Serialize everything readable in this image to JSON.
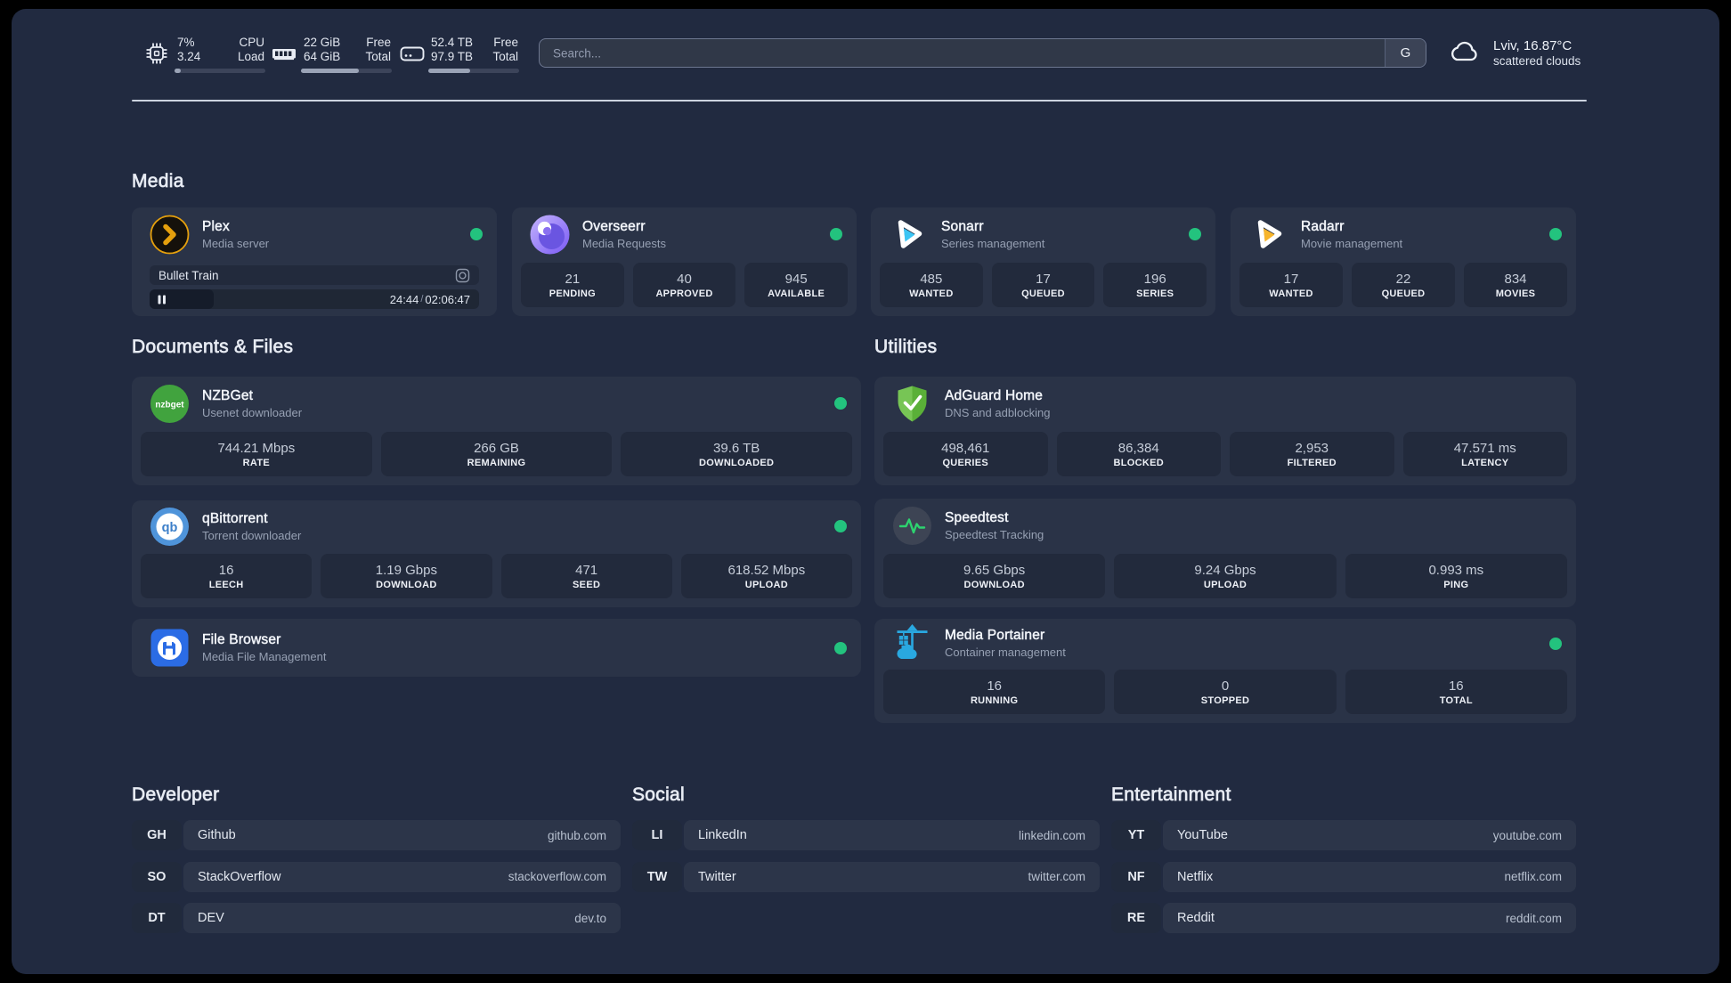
{
  "topbar": {
    "cpu": {
      "icon": "cpu-icon",
      "value_top": "7%",
      "value_bottom": "3.24",
      "label_top": "CPU",
      "label_bottom": "Load",
      "progress_percent": 7
    },
    "memory": {
      "icon": "ram-icon",
      "value_top": "22 GiB",
      "value_bottom": "64 GiB",
      "label_top": "Free",
      "label_bottom": "Total",
      "progress_percent": 64
    },
    "disk": {
      "icon": "disk-icon",
      "value_top": "52.4 TB",
      "value_bottom": "97.9 TB",
      "label_top": "Free",
      "label_bottom": "Total",
      "progress_percent": 46
    },
    "search": {
      "placeholder": "Search...",
      "button_label": "G"
    },
    "weather": {
      "icon": "cloud-icon",
      "line1": "Lviv, 16.87°C",
      "line2": "scattered clouds"
    }
  },
  "app_sections": [
    {
      "id": "media",
      "heading": "Media",
      "cards": [
        {
          "id": "plex",
          "icon": "plex-icon",
          "title": "Plex",
          "subtitle": "Media server",
          "status_dot": true,
          "player": {
            "track_title": "Bullet Train",
            "track_icon": "disc-icon",
            "state_icon": "pause-icon",
            "position": "24:44",
            "duration": "02:06:47",
            "progress_percent": 19.5
          }
        },
        {
          "id": "overseerr",
          "icon": "overseerr-icon",
          "title": "Overseerr",
          "subtitle": "Media Requests",
          "status_dot": true,
          "stats": [
            {
              "value": "21",
              "label": "PENDING"
            },
            {
              "value": "40",
              "label": "APPROVED"
            },
            {
              "value": "945",
              "label": "AVAILABLE"
            }
          ]
        },
        {
          "id": "sonarr",
          "icon": "sonarr-icon",
          "title": "Sonarr",
          "subtitle": "Series management",
          "status_dot": true,
          "stats": [
            {
              "value": "485",
              "label": "WANTED"
            },
            {
              "value": "17",
              "label": "QUEUED"
            },
            {
              "value": "196",
              "label": "SERIES"
            }
          ]
        },
        {
          "id": "radarr",
          "icon": "radarr-icon",
          "title": "Radarr",
          "subtitle": "Movie management",
          "status_dot": true,
          "stats": [
            {
              "value": "17",
              "label": "WANTED"
            },
            {
              "value": "22",
              "label": "QUEUED"
            },
            {
              "value": "834",
              "label": "MOVIES"
            }
          ]
        }
      ]
    },
    {
      "id": "documents",
      "heading": "Documents & Files",
      "cards": [
        {
          "id": "nzbget",
          "icon": "nzbget-icon",
          "title": "NZBGet",
          "subtitle": "Usenet downloader",
          "status_dot": true,
          "stats": [
            {
              "value": "744.21 Mbps",
              "label": "RATE"
            },
            {
              "value": "266 GB",
              "label": "REMAINING"
            },
            {
              "value": "39.6 TB",
              "label": "DOWNLOADED"
            }
          ]
        },
        {
          "id": "qbittorrent",
          "icon": "qbittorrent-icon",
          "title": "qBittorrent",
          "subtitle": "Torrent downloader",
          "status_dot": true,
          "stats": [
            {
              "value": "16",
              "label": "LEECH"
            },
            {
              "value": "1.19 Gbps",
              "label": "DOWNLOAD"
            },
            {
              "value": "471",
              "label": "SEED"
            },
            {
              "value": "618.52 Mbps",
              "label": "UPLOAD"
            }
          ]
        },
        {
          "id": "filebrowser",
          "icon": "filebrowser-icon",
          "title": "File Browser",
          "subtitle": "Media File Management",
          "status_dot": true,
          "stats": null
        }
      ]
    },
    {
      "id": "utilities",
      "heading": "Utilities",
      "cards": [
        {
          "id": "adguard",
          "icon": "adguard-icon",
          "title": "AdGuard Home",
          "subtitle": "DNS and adblocking",
          "status_dot": false,
          "stats": [
            {
              "value": "498,461",
              "label": "QUERIES"
            },
            {
              "value": "86,384",
              "label": "BLOCKED"
            },
            {
              "value": "2,953",
              "label": "FILTERED"
            },
            {
              "value": "47.571 ms",
              "label": "LATENCY"
            }
          ]
        },
        {
          "id": "speedtest",
          "icon": "speedtest-icon",
          "title": "Speedtest",
          "subtitle": "Speedtest Tracking",
          "status_dot": false,
          "stats": [
            {
              "value": "9.65 Gbps",
              "label": "DOWNLOAD"
            },
            {
              "value": "9.24 Gbps",
              "label": "UPLOAD"
            },
            {
              "value": "0.993 ms",
              "label": "PING"
            }
          ]
        },
        {
          "id": "portainer",
          "icon": "portainer-icon",
          "title": "Media Portainer",
          "subtitle": "Container management",
          "status_dot": true,
          "stats": [
            {
              "value": "16",
              "label": "RUNNING"
            },
            {
              "value": "0",
              "label": "STOPPED"
            },
            {
              "value": "16",
              "label": "TOTAL"
            }
          ]
        }
      ]
    }
  ],
  "link_sections": [
    {
      "id": "developer",
      "heading": "Developer",
      "links": [
        {
          "abbr": "GH",
          "name": "Github",
          "url": "github.com"
        },
        {
          "abbr": "SO",
          "name": "StackOverflow",
          "url": "stackoverflow.com"
        },
        {
          "abbr": "DT",
          "name": "DEV",
          "url": "dev.to"
        }
      ]
    },
    {
      "id": "social",
      "heading": "Social",
      "links": [
        {
          "abbr": "LI",
          "name": "LinkedIn",
          "url": "linkedin.com"
        },
        {
          "abbr": "TW",
          "name": "Twitter",
          "url": "twitter.com"
        }
      ]
    },
    {
      "id": "entertainment",
      "heading": "Entertainment",
      "links": [
        {
          "abbr": "YT",
          "name": "YouTube",
          "url": "youtube.com"
        },
        {
          "abbr": "NF",
          "name": "Netflix",
          "url": "netflix.com"
        },
        {
          "abbr": "RE",
          "name": "Reddit",
          "url": "reddit.com"
        }
      ]
    }
  ]
}
